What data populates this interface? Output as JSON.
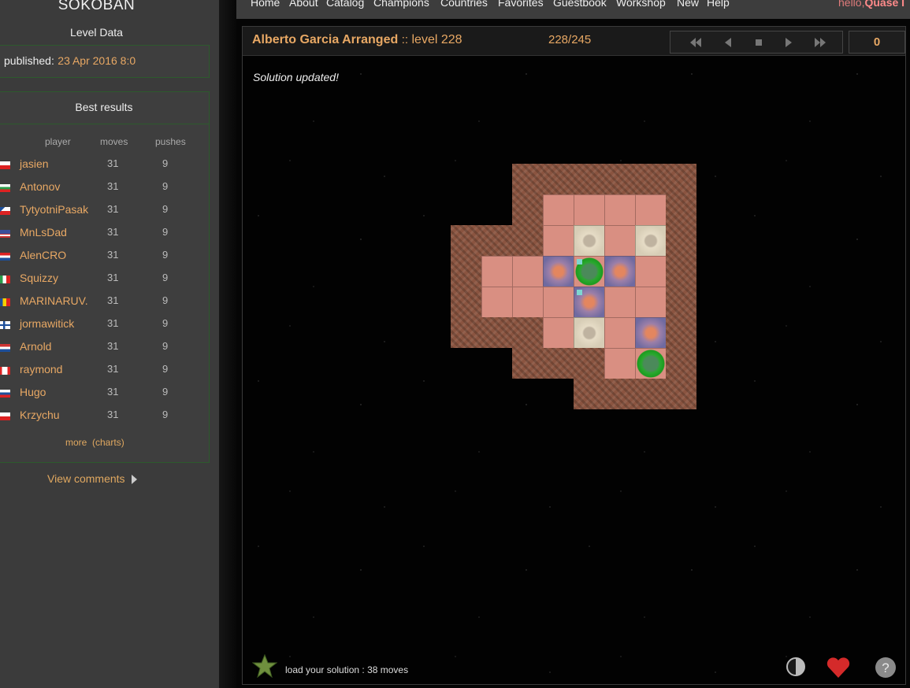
{
  "sidebar": {
    "logo": "SOKOBAN",
    "level_data_title": "Level Data",
    "published_label": "published:",
    "published_value": "23 Apr 2016 8:0",
    "best_results_title": "Best results",
    "columns": {
      "player": "player",
      "moves": "moves",
      "pushes": "pushes"
    },
    "results": [
      {
        "player": "jasien",
        "moves": "31",
        "pushes": "9",
        "flag": "pl"
      },
      {
        "player": "Antonov",
        "moves": "31",
        "pushes": "9",
        "flag": "bg"
      },
      {
        "player": "TytyotniPasak",
        "moves": "31",
        "pushes": "9",
        "flag": "cz"
      },
      {
        "player": "MnLsDad",
        "moves": "31",
        "pushes": "9",
        "flag": "us"
      },
      {
        "player": "AlenCRO",
        "moves": "31",
        "pushes": "9",
        "flag": "hr"
      },
      {
        "player": "Squizzy",
        "moves": "31",
        "pushes": "9",
        "flag": "it"
      },
      {
        "player": "MARINARUV.",
        "moves": "31",
        "pushes": "9",
        "flag": "ro"
      },
      {
        "player": "jormawitick",
        "moves": "31",
        "pushes": "9",
        "flag": "fi"
      },
      {
        "player": "Arnold",
        "moves": "31",
        "pushes": "9",
        "flag": "nl"
      },
      {
        "player": "raymond",
        "moves": "31",
        "pushes": "9",
        "flag": "ca"
      },
      {
        "player": "Hugo",
        "moves": "31",
        "pushes": "9",
        "flag": "sk"
      },
      {
        "player": "Krzychu",
        "moves": "31",
        "pushes": "9",
        "flag": "pl"
      }
    ],
    "more_label": "more",
    "charts_label": "(charts)",
    "view_comments": "View comments"
  },
  "nav": {
    "items": [
      "Home",
      "About",
      "Catalog",
      "Champions",
      "Countries",
      "Favorites",
      "Guestbook",
      "Workshop",
      "New",
      "Help"
    ],
    "hello": "hello,",
    "user": "Quase I"
  },
  "level": {
    "collection": "Alberto Garcia Arranged",
    "separator": "::",
    "name": "level 228",
    "counter": "228/245",
    "move_count": "0",
    "message": "Solution updated!",
    "load_solution": "load your solution : 38 moves"
  },
  "controls": [
    "first-icon",
    "prev-icon",
    "stop-icon",
    "next-icon",
    "last-icon"
  ],
  "colors": {
    "accent": "#e8a864",
    "wall": "#8a5440",
    "floor": "#d98f82",
    "player": "#2aa82f"
  },
  "board": {
    "rows": [
      "  ######",
      "  #    #",
      "### * *#",
      "#  .@. #",
      "#   .  #",
      "### * .#",
      "  ### @#",
      "    ####"
    ],
    "legend": {
      "#": "wall",
      " ": "floor",
      "*": "box",
      ".": "goal",
      "@": "player"
    }
  }
}
